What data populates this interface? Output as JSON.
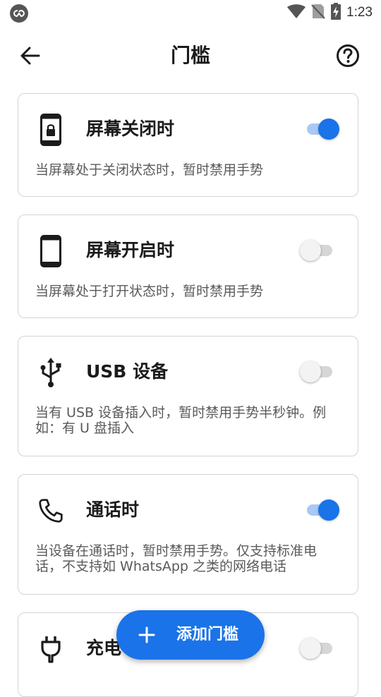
{
  "status_bar": {
    "time": "1:23"
  },
  "app_bar": {
    "title": "门槛"
  },
  "thresholds": [
    {
      "title": "屏幕关闭时",
      "description": "当屏幕处于关闭状态时，暂时禁用手势",
      "enabled": true,
      "icon": "phone-lock-icon"
    },
    {
      "title": "屏幕开启时",
      "description": "当屏幕处于打开状态时，暂时禁用手势",
      "enabled": false,
      "icon": "phone-icon"
    },
    {
      "title": "USB 设备",
      "description": "当有 USB 设备插入时，暂时禁用手势半秒钟。例如：有 U 盘插入",
      "enabled": false,
      "icon": "usb-icon"
    },
    {
      "title": "通话时",
      "description": "当设备在通话时，暂时禁用手势。仅支持标准电话，不支持如 WhatsApp 之类的网络电话",
      "enabled": true,
      "icon": "phone-call-icon"
    },
    {
      "title": "充电",
      "description": "",
      "enabled": false,
      "icon": "power-plug-icon"
    }
  ],
  "fab": {
    "label": "添加门槛"
  },
  "colors": {
    "accent": "#1a73e8",
    "border": "#d4d4d4",
    "secondary_text": "#5a5a5a"
  }
}
